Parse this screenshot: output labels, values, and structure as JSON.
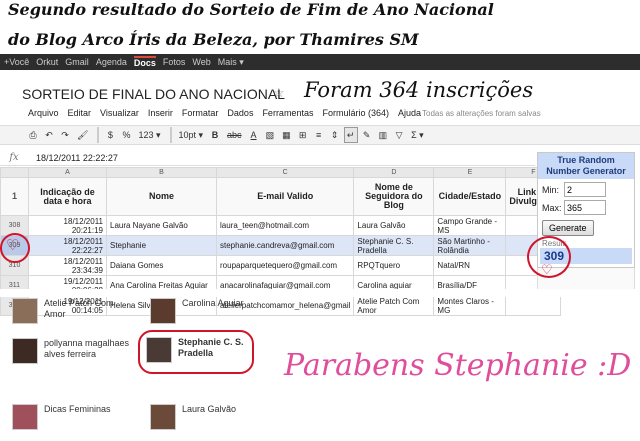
{
  "headline": {
    "line1": "Segundo resultado do Sorteio de Fim de Ano Nacional",
    "line2": "do Blog Arco Íris da Beleza, por Thamires SM"
  },
  "google_bar": [
    "+Você",
    "Orkut",
    "Gmail",
    "Agenda",
    "Docs",
    "Fotos",
    "Web",
    "Mais ▾"
  ],
  "google_bar_active": "Docs",
  "doc_title": "SORTEIO DE FINAL DO ANO NACIONAL",
  "hand_note": "Foram 364 inscrições",
  "menu": [
    "Arquivo",
    "Editar",
    "Visualizar",
    "Inserir",
    "Formatar",
    "Dados",
    "Ferramentas",
    "Formulário (364)",
    "Ajuda"
  ],
  "saved_note": "Todas as alterações foram salvas",
  "toolbar": {
    "percent": "%",
    "decimals": "123 ▾",
    "font_size": "10pt ▾",
    "bold": "B",
    "strike": "abc",
    "text_color": "A",
    "sigma": "Σ ▾"
  },
  "formula_bar": {
    "value": "18/12/2011 22:22:27"
  },
  "grid": {
    "columns": [
      "A",
      "B",
      "C",
      "D",
      "E",
      "F"
    ],
    "header_row_num": "1",
    "headers": [
      "Indicação de data e hora",
      "Nome",
      "E-mail Valido",
      "Nome de Seguidora do Blog",
      "Cidade/Estado",
      "Link de Divulgação"
    ],
    "rows": [
      {
        "num": "308",
        "date": "18/12/2011",
        "time": "20:21:19",
        "nome": "Laura Nayane Galvão",
        "email": "laura_teen@hotmail.com",
        "seguidora": "Laura Galvão",
        "cidade": "Campo Grande - MS",
        "link": ""
      },
      {
        "num": "309",
        "date": "18/12/2011",
        "time": "22:22:27",
        "nome": "Stephanie",
        "email": "stephanie.candreva@gmail.com",
        "seguidora": "Stephanie C. S. Pradella",
        "cidade": "São Martinho - Rolândia",
        "link": ""
      },
      {
        "num": "310",
        "date": "18/12/2011",
        "time": "23:34:39",
        "nome": "Daiana Gomes",
        "email": "roupaparquetequero@gmail.com",
        "seguidora": "RPQTquero",
        "cidade": "Natal/RN",
        "link": ""
      },
      {
        "num": "311",
        "date": "19/12/2011",
        "time": "00:06:28",
        "nome": "Ana Carolina Freitas Aguiar",
        "email": "anacarolinafaguiar@gmail.com",
        "seguidora": "Carolina aguiar",
        "cidade": "Brasília/DF",
        "link": ""
      },
      {
        "num": "312",
        "date": "19/12/2011",
        "time": "00:14:05",
        "nome": "Helena Silva",
        "email": "atelierpatchcomamor_helena@gmail",
        "seguidora": "Atelie Patch Com Amor",
        "cidade": "Montes Claros - MG",
        "link": ""
      }
    ]
  },
  "rng": {
    "title": "True Random Number Generator",
    "min_label": "Min:",
    "min_value": "2",
    "max_label": "Max:",
    "max_value": "365",
    "button": "Generate",
    "result_label": "Result:",
    "result": "309"
  },
  "followers": [
    {
      "name": "Atelie Patch Com Amor",
      "avatar_color": "#8a6e5a"
    },
    {
      "name": "Carolina Aguiar",
      "avatar_color": "#5a3b2e"
    },
    {
      "name": "pollyanna magalhaes alves ferreira",
      "avatar_color": "#3d2a22"
    },
    {
      "name": "Stephanie C. S. Pradella",
      "avatar_color": "#4a3a35"
    },
    {
      "name": "Dicas Femininas",
      "avatar_color": "#a0505a"
    },
    {
      "name": "Laura Galvão",
      "avatar_color": "#6b4a3a"
    }
  ],
  "congrats": "Parabens Stephanie :D",
  "colors": {
    "accent_red": "#d0142b",
    "congrats_pink": "#e04d9a",
    "selection_blue": "#dde6f7"
  }
}
